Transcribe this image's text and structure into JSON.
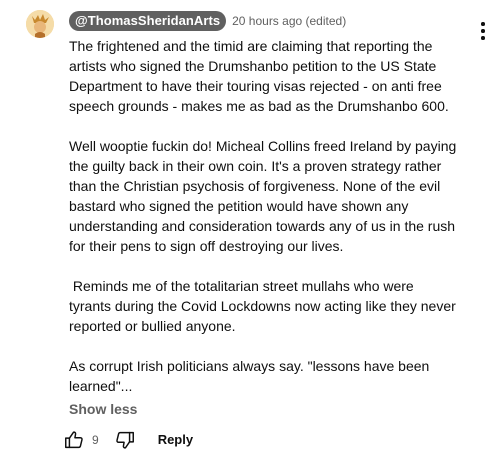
{
  "comment": {
    "author": "@ThomasSheridanArts",
    "timestamp": "20 hours ago (edited)",
    "paragraphs": [
      "The frightened and the timid are claiming that reporting the artists who signed the Drumshanbo petition to the US State Department to have their touring visas rejected - on anti free speech grounds - makes me as bad as the Drumshanbo 600.",
      "Well wooptie fuckin do! Micheal Collins freed Ireland by paying the guilty back in their own coin. It's a proven strategy rather than the Christian psychosis of forgiveness. None of the evil bastard who signed the petition would have shown any understanding and consideration towards any of us in the rush for their pens to sign off destroying our lives.",
      " Reminds me of the totalitarian street mullahs who were tyrants during the Covid Lockdowns now acting like they never reported or bullied anyone.",
      "As corrupt Irish politicians always say. \"lessons have been learned\"..."
    ],
    "show_less_label": "Show less",
    "like_count": "9",
    "reply_label": "Reply"
  },
  "icons": {
    "avatar": "avatar-cartoon",
    "menu": "more-vert-icon",
    "like": "thumb-up-icon",
    "dislike": "thumb-down-icon"
  },
  "colors": {
    "author_pill_bg": "#606060",
    "secondary_text": "#606060",
    "primary_text": "#0f0f0f"
  }
}
